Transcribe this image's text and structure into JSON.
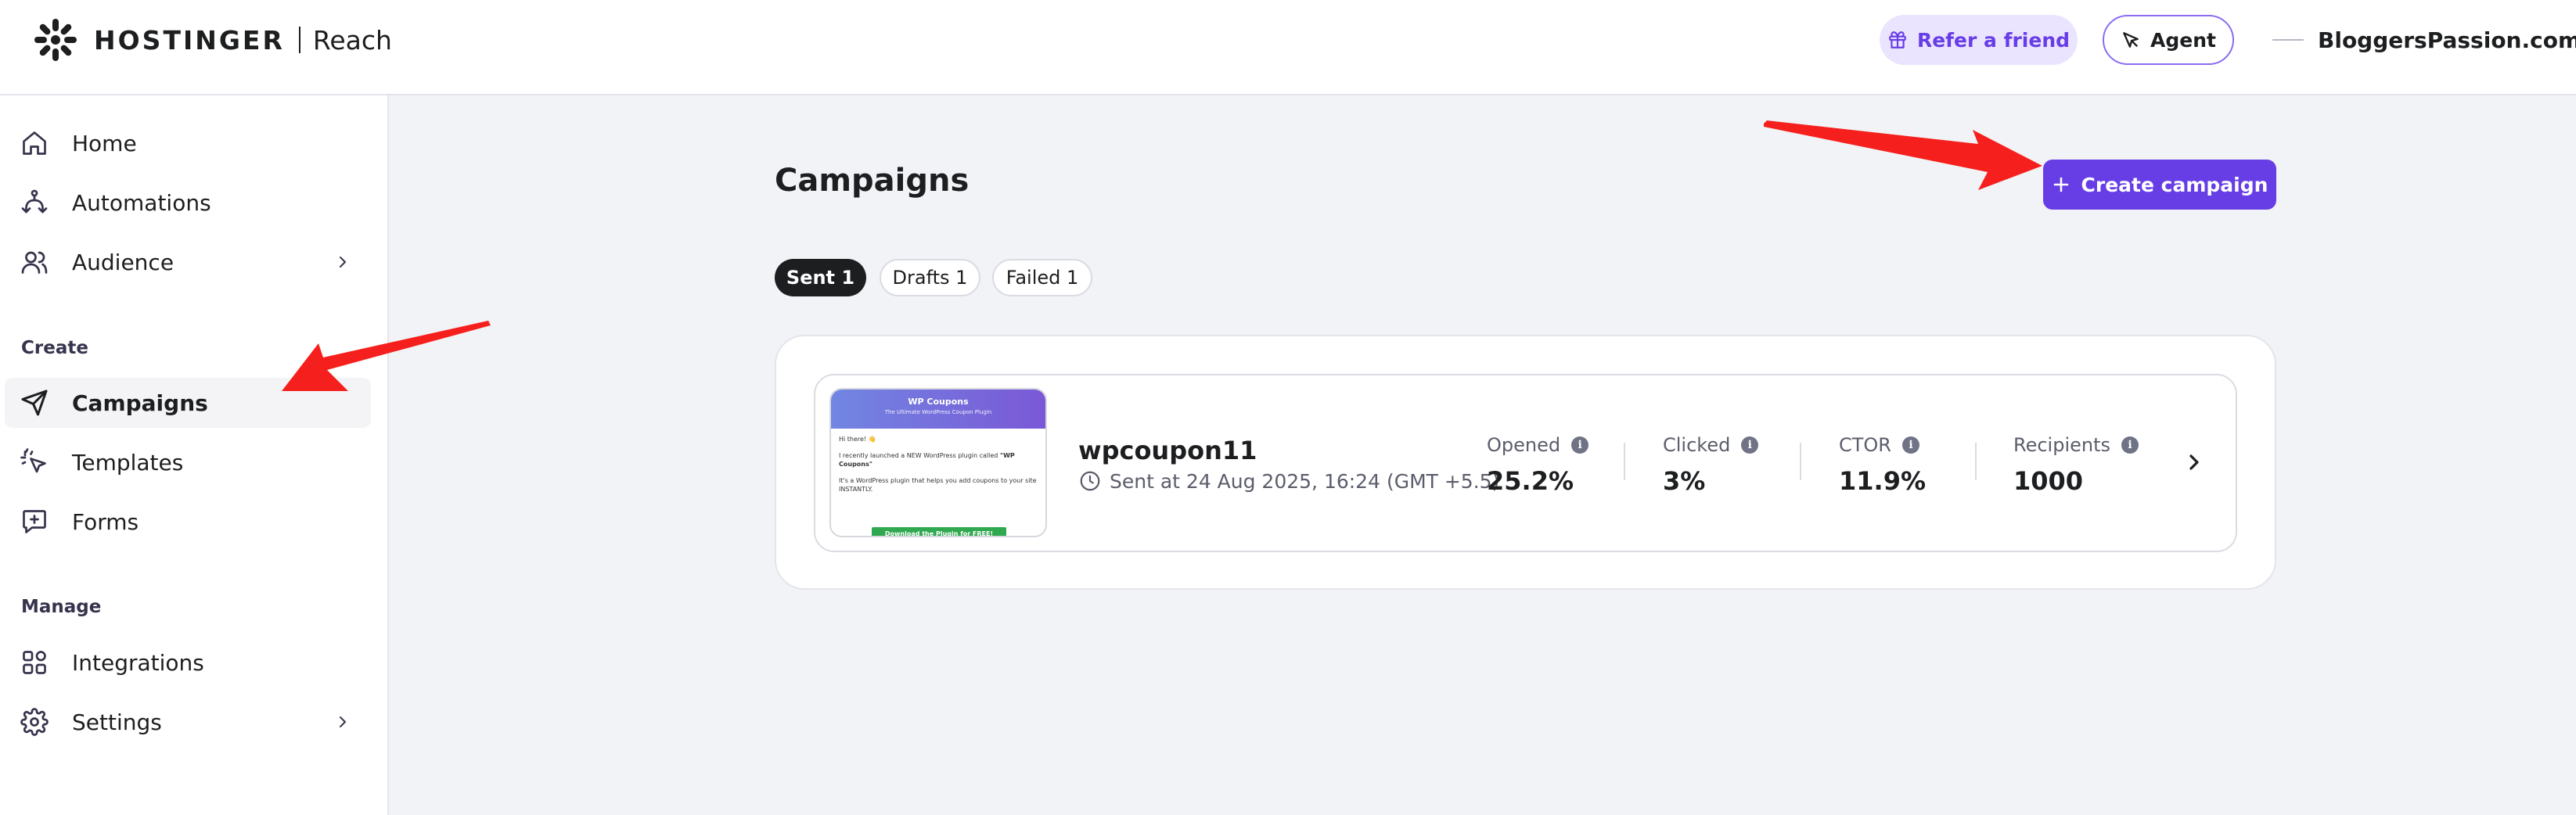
{
  "header": {
    "brand": "HOSTINGER",
    "product": "Reach",
    "refer_label": "Refer a friend",
    "agent_label": "Agent",
    "site_name": "BloggersPassion.com"
  },
  "sidebar": {
    "items_top": [
      {
        "label": "Home",
        "icon": "home-icon"
      },
      {
        "label": "Automations",
        "icon": "automations-icon"
      },
      {
        "label": "Audience",
        "icon": "audience-icon"
      }
    ],
    "create_section_label": "Create",
    "items_create": [
      {
        "label": "Campaigns",
        "icon": "paper-plane-icon",
        "active": true
      },
      {
        "label": "Templates",
        "icon": "templates-icon"
      },
      {
        "label": "Forms",
        "icon": "forms-icon"
      }
    ],
    "manage_section_label": "Manage",
    "items_manage": [
      {
        "label": "Integrations",
        "icon": "integrations-icon"
      },
      {
        "label": "Settings",
        "icon": "gear-icon"
      }
    ]
  },
  "main": {
    "title": "Campaigns",
    "create_label": "Create campaign",
    "tabs": [
      {
        "label": "Sent 1",
        "active": true
      },
      {
        "label": "Drafts 1",
        "active": false
      },
      {
        "label": "Failed 1",
        "active": false
      }
    ],
    "campaign": {
      "name": "wpcoupon11",
      "sent": "Sent at 24 Aug 2025, 16:24 (GMT +5.5)",
      "preview": {
        "title": "WP Coupons",
        "subtitle": "The Ultimate WordPress Coupon Plugin",
        "greeting": "Hi there! 👋",
        "line1_prefix": "I recently launched a NEW WordPress plugin called ",
        "line1_bold": "\"WP Coupons\"",
        "line2": "It's a WordPress plugin that helps you add coupons to your site INSTANTLY.",
        "cta": "Download the Plugin for FREE!"
      },
      "stats": [
        {
          "label": "Opened",
          "value": "25.2%"
        },
        {
          "label": "Clicked",
          "value": "3%"
        },
        {
          "label": "CTOR",
          "value": "11.9%"
        },
        {
          "label": "Recipients",
          "value": "1000"
        }
      ]
    }
  },
  "colors": {
    "accent": "#673de6",
    "annotation_arrow": "#f5201d",
    "cta_green": "#2fa84f"
  }
}
